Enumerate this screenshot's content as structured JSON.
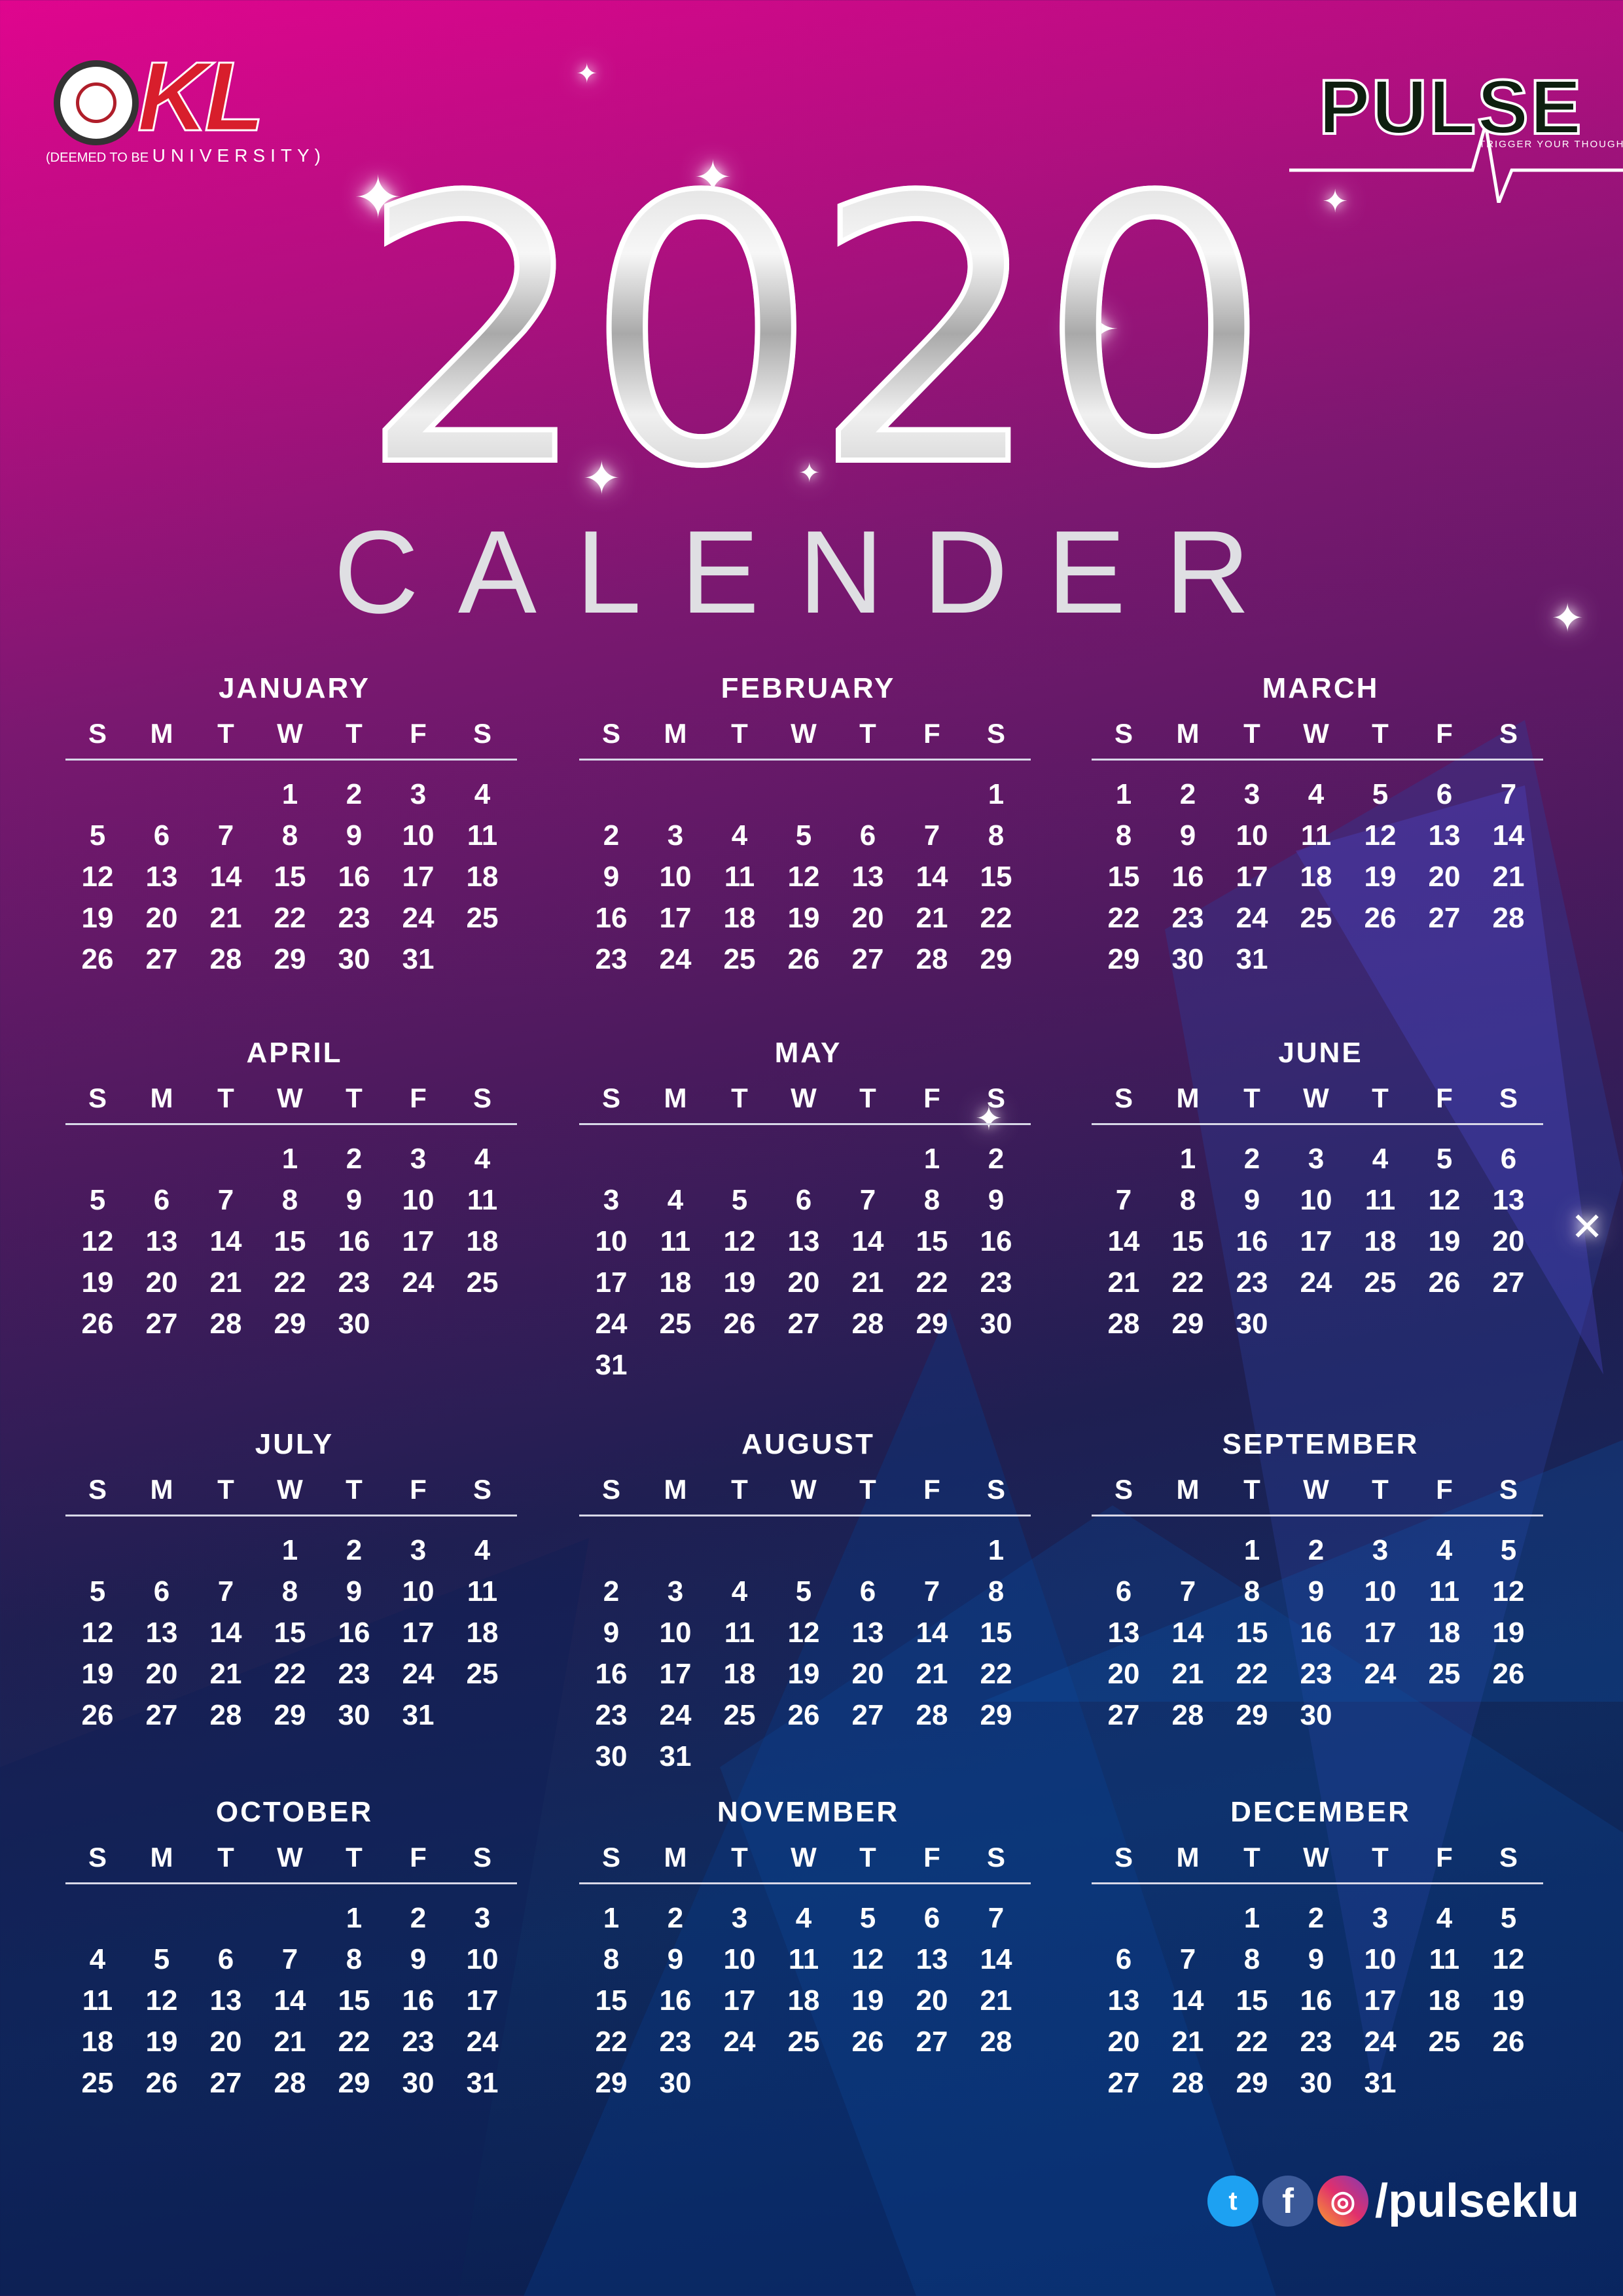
{
  "header": {
    "university": {
      "logo_text": "KL",
      "sub_prefix": "(DEEMED TO BE",
      "sub_name": "UNIVERSITY)"
    },
    "club": {
      "logo_text": "PULSE",
      "tagline": "TRIGGER YOUR THOUGHT"
    }
  },
  "title": {
    "year": "2020",
    "subtitle": "CALENDER"
  },
  "weekday_labels": [
    "S",
    "M",
    "T",
    "W",
    "T",
    "F",
    "S"
  ],
  "months": [
    {
      "name": "JANUARY",
      "offset": 3,
      "days": 31
    },
    {
      "name": "FEBRUARY",
      "offset": 6,
      "days": 29
    },
    {
      "name": "MARCH",
      "offset": 0,
      "days": 31
    },
    {
      "name": "APRIL",
      "offset": 3,
      "days": 30
    },
    {
      "name": "MAY",
      "offset": 5,
      "days": 31
    },
    {
      "name": "JUNE",
      "offset": 1,
      "days": 30
    },
    {
      "name": "JULY",
      "offset": 3,
      "days": 31
    },
    {
      "name": "AUGUST",
      "offset": 6,
      "days": 31
    },
    {
      "name": "SEPTEMBER",
      "offset": 2,
      "days": 30
    },
    {
      "name": "OCTOBER",
      "offset": 4,
      "days": 31
    },
    {
      "name": "NOVEMBER",
      "offset": 0,
      "days": 30
    },
    {
      "name": "DECEMBER",
      "offset": 2,
      "days": 31
    }
  ],
  "social": {
    "icons": [
      "twitter-icon",
      "facebook-icon",
      "instagram-icon"
    ],
    "handle": "/pulseklu"
  },
  "colors": {
    "top_magenta": "#e0058e",
    "bottom_navy": "#09194a",
    "kl_red": "#d81e2c",
    "text": "#ffffff"
  }
}
